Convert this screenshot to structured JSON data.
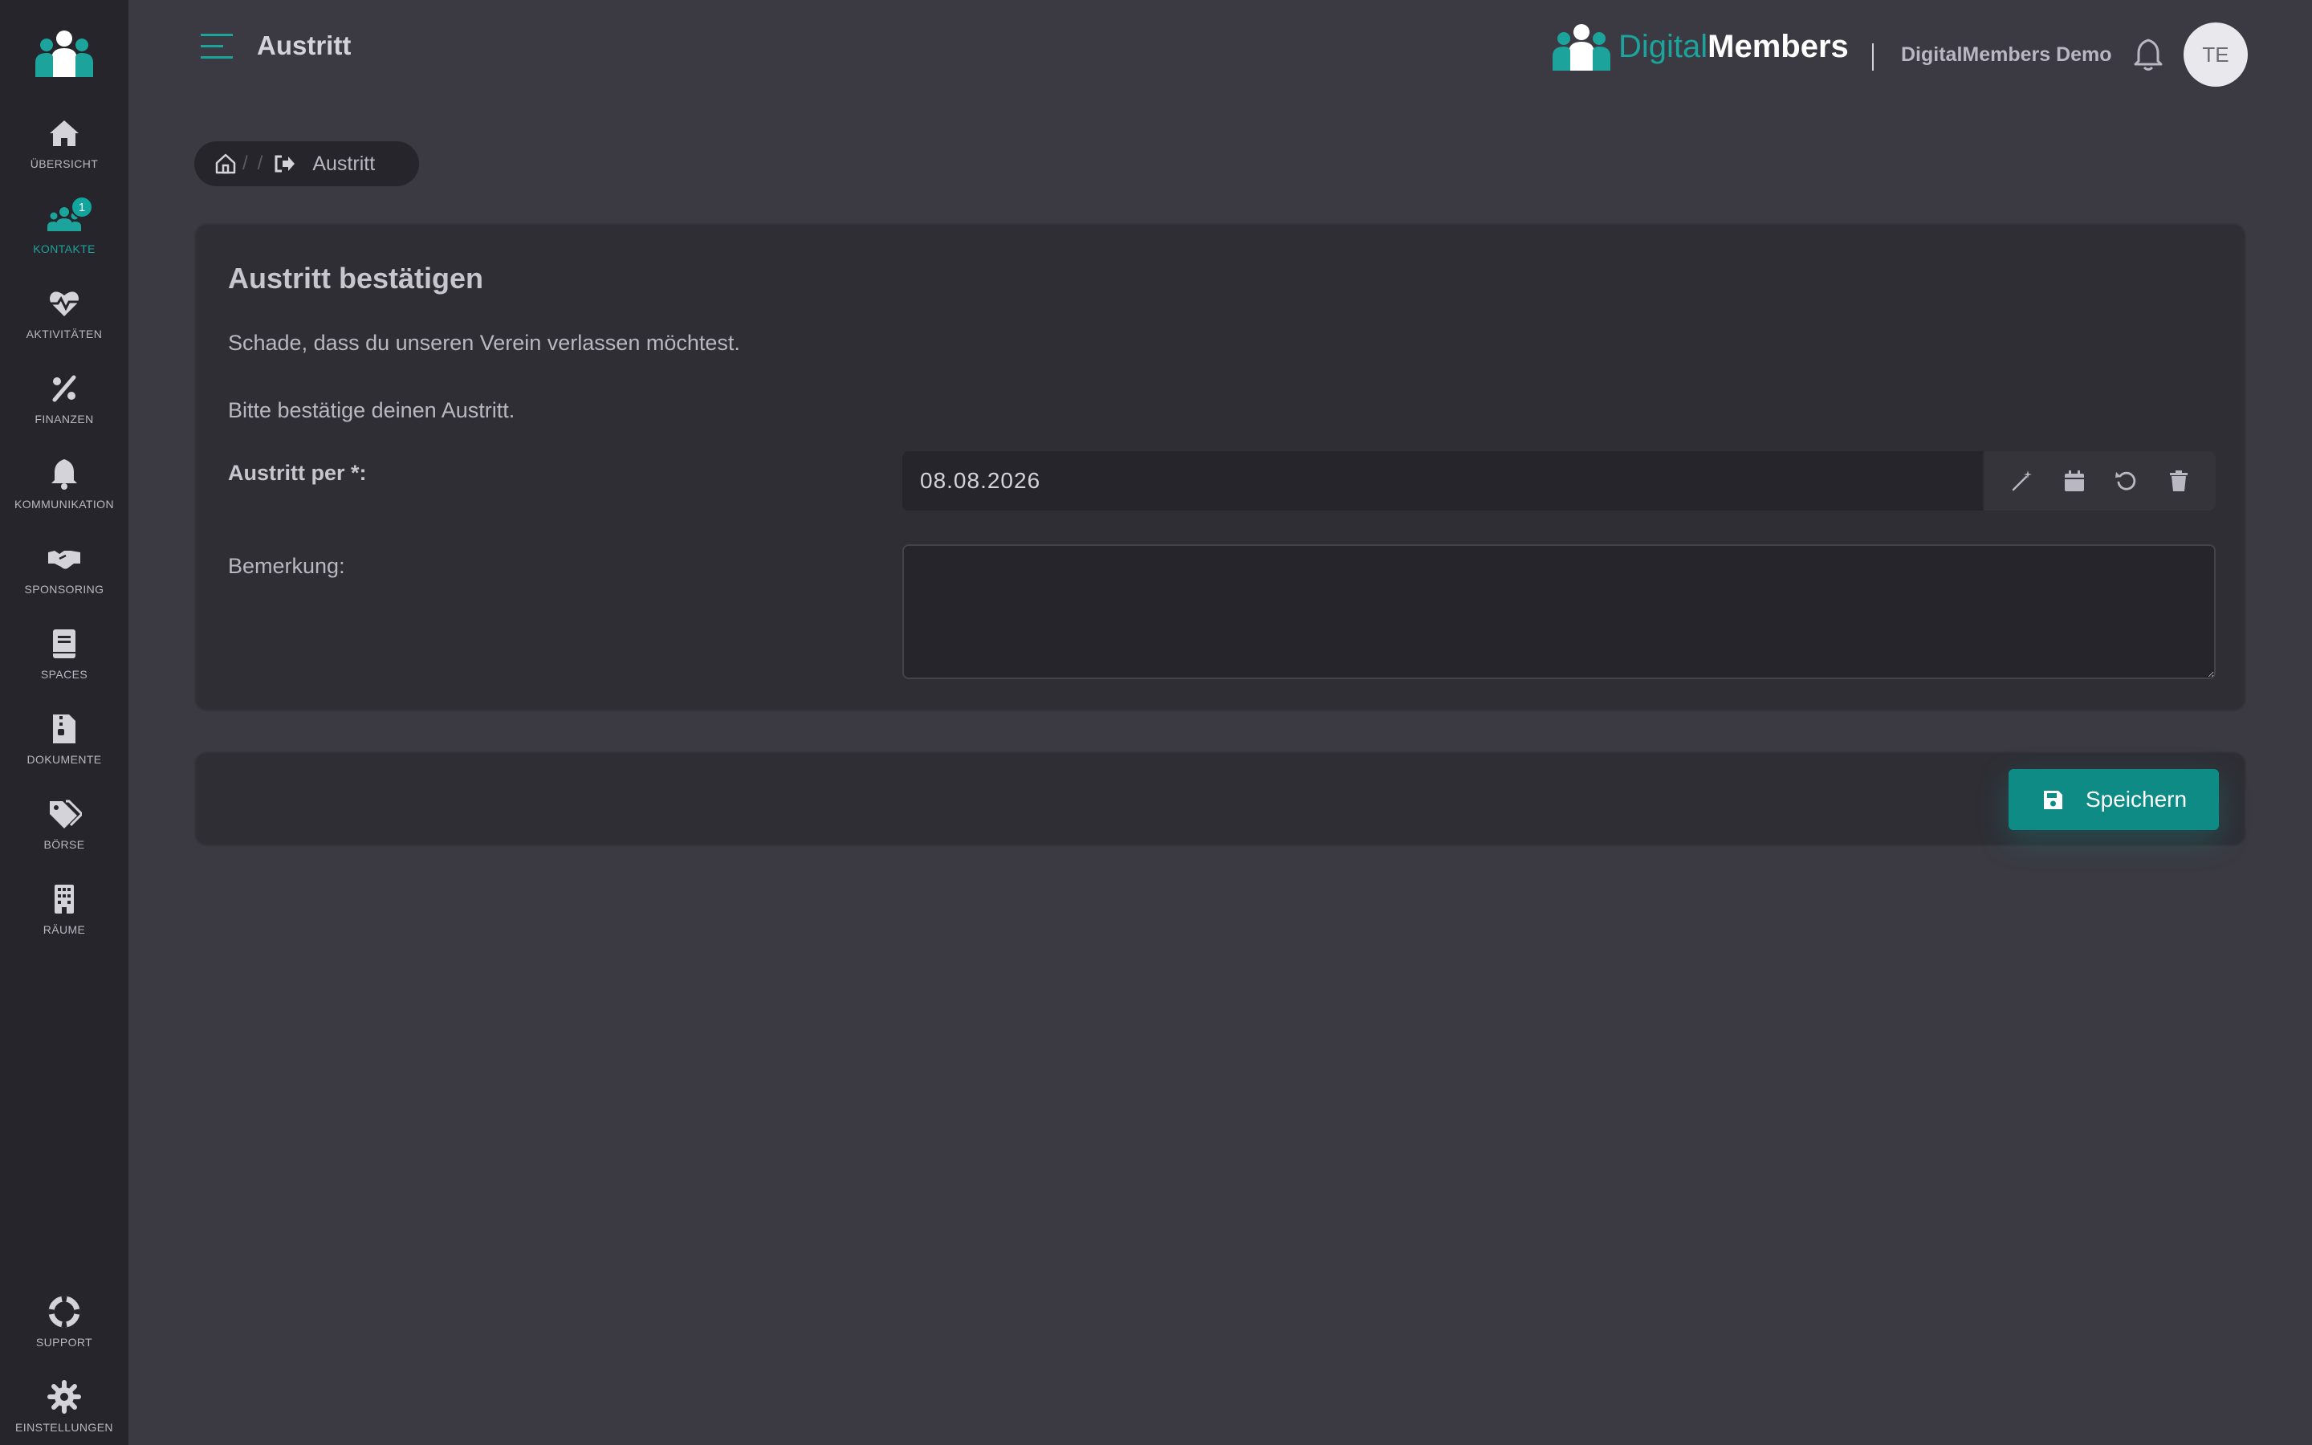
{
  "colors": {
    "accent": "#1ba39c",
    "button": "#0f8b86",
    "sidebar": "#26252b",
    "background": "#3b3a42",
    "card": "#2f2e35"
  },
  "header": {
    "title": "Austritt",
    "menu_icon": "hamburger-menu-icon",
    "brand_part1": "Digital",
    "brand_part2": "Members",
    "org_name": "DigitalMembers Demo",
    "notification_icon": "bell-icon",
    "avatar_initials": "TE"
  },
  "sidebar": {
    "items": [
      {
        "label": "Übersicht",
        "icon": "home-icon"
      },
      {
        "label": "Kontakte",
        "icon": "users-icon",
        "badge": "1",
        "active": true
      },
      {
        "label": "Aktivitäten",
        "icon": "heartbeat-icon"
      },
      {
        "label": "Finanzen",
        "icon": "percent-icon"
      },
      {
        "label": "Kommunikation",
        "icon": "bell-icon"
      },
      {
        "label": "Sponsoring",
        "icon": "handshake-icon"
      },
      {
        "label": "Spaces",
        "icon": "book-icon"
      },
      {
        "label": "Dokumente",
        "icon": "file-zipper-icon"
      },
      {
        "label": "Börse",
        "icon": "tags-icon"
      },
      {
        "label": "Räume",
        "icon": "building-icon"
      }
    ],
    "bottom_items": [
      {
        "label": "Support",
        "icon": "life-ring-icon"
      },
      {
        "label": "Einstellungen",
        "icon": "gear-icon"
      }
    ]
  },
  "breadcrumb": {
    "home_icon": "home-outline-icon",
    "separator": "/",
    "current_icon": "sign-out-icon",
    "current_label": "Austritt"
  },
  "form": {
    "title": "Austritt bestätigen",
    "text1": "Schade, dass du unseren Verein verlassen möchtest.",
    "text2": "Bitte bestätige deinen Austritt.",
    "date_label": "Austritt per *:",
    "date_value": "08.08.2026",
    "date_tools": [
      "magic-wand-icon",
      "calendar-icon",
      "reset-icon",
      "trash-icon"
    ],
    "remark_label": "Bemerkung:",
    "remark_value": ""
  },
  "footer": {
    "save_label": "Speichern",
    "save_icon": "floppy-disk-icon"
  }
}
